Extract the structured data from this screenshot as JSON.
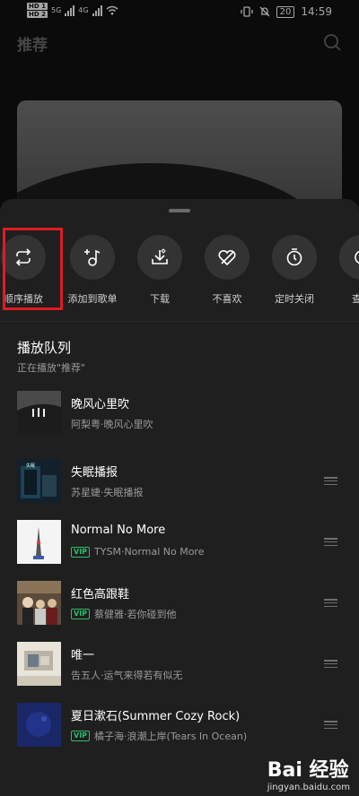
{
  "status_bar": {
    "sim1": "HD 1",
    "sim2": "HD 2",
    "net1": "5G",
    "net2": "4G",
    "battery": "20",
    "time": "14:59"
  },
  "background": {
    "title": "推荐"
  },
  "actions": [
    {
      "label": "顺序播放",
      "icon": "repeat-icon"
    },
    {
      "label": "添加到歌单",
      "icon": "add-to-playlist-icon"
    },
    {
      "label": "下载",
      "icon": "download-icon"
    },
    {
      "label": "不喜欢",
      "icon": "dislike-heart-icon"
    },
    {
      "label": "定时关闭",
      "icon": "timer-icon"
    },
    {
      "label": "查看",
      "icon": "view-icon"
    }
  ],
  "queue": {
    "title": "播放队列",
    "subtitle": "正在播放\"推荐\"",
    "songs": [
      {
        "title": "晚风心里吹",
        "artist": "阿梨粤",
        "album": "晚风心里吹",
        "vip": false
      },
      {
        "title": "失眠播报",
        "artist": "苏星婕",
        "album": "失眠播报",
        "vip": false
      },
      {
        "title": "Normal No More",
        "artist": "TYSM",
        "album": "Normal No More",
        "vip": true
      },
      {
        "title": "红色高跟鞋",
        "artist": "蔡健雅",
        "album": "若你碰到他",
        "vip": true
      },
      {
        "title": "唯一",
        "artist": "告五人",
        "album": "运气来得若有似无",
        "vip": false
      },
      {
        "title": "夏日漱石(Summer Cozy Rock)",
        "artist": "橘子海",
        "album": "浪潮上岸(Tears In Ocean)",
        "vip": true
      }
    ]
  },
  "vip_label": "VIP",
  "separator": " · ",
  "watermark": {
    "brand": "Bai 经验",
    "url": "jingyan.baidu.com"
  }
}
